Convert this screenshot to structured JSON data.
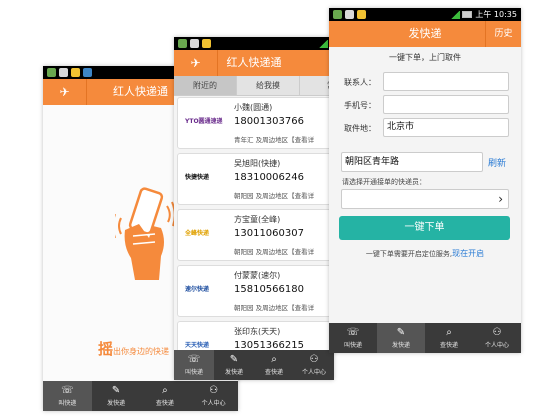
{
  "colors": {
    "brand": "#f58a3c",
    "teal": "#25b3a4",
    "link": "#2a7bd4",
    "tabbar": "#3a3a3a"
  },
  "tabs": [
    {
      "label": "叫快递",
      "icon": "phone-icon"
    },
    {
      "label": "发快递",
      "icon": "edit-icon"
    },
    {
      "label": "查快递",
      "icon": "search-icon"
    },
    {
      "label": "个人中心",
      "icon": "person-icon"
    }
  ],
  "screen1": {
    "title": "红人快递通",
    "slogan_big": "摇",
    "slogan_rest": "出你身边的快递"
  },
  "screen2": {
    "title": "红人快递通",
    "segments": [
      "附近的",
      "给我摸",
      "常"
    ],
    "couriers": [
      {
        "name": "小魏(圆通)",
        "phone": "18001303766",
        "area": "青年汇 及周边地区【查看详",
        "logo": "YTO圆通速递",
        "logo_color": "#6a2c8c"
      },
      {
        "name": "吴旭阳(快捷)",
        "phone": "18310006246",
        "area": "朝阳园 及周边地区【查看详",
        "logo": "快捷快递",
        "logo_color": "#111111"
      },
      {
        "name": "方宝童(全峰)",
        "phone": "13011060307",
        "area": "朝阳园 及周边地区【查看详",
        "logo": "全峰快递",
        "logo_color": "#e0a100"
      },
      {
        "name": "付蒙蒙(速尔)",
        "phone": "15810566180",
        "area": "朝阳园 及周边地区【查看详",
        "logo": "速尔快递",
        "logo_color": "#1f4fa0"
      },
      {
        "name": "张印东(天天)",
        "phone": "13051366215",
        "area": "",
        "logo": "天天快递",
        "logo_color": "#2a5fb5"
      }
    ]
  },
  "screen3": {
    "title": "发快递",
    "history": "历史",
    "subtitle": "一键下单，上门取件",
    "contact_label": "联系人：",
    "contact_value": "",
    "phone_label": "手机号：",
    "phone_value": "",
    "pickup_label": "取件地：",
    "pickup_city": "北京市",
    "address_value": "朝阳区青年路",
    "refresh": "刷新",
    "select_hint": "请选择开通接单的快递员：",
    "order_button": "一键下单",
    "notice_text": "一键下单需要开启定位服务,",
    "notice_link": "现在开启",
    "status_time": "上午 10:35"
  }
}
